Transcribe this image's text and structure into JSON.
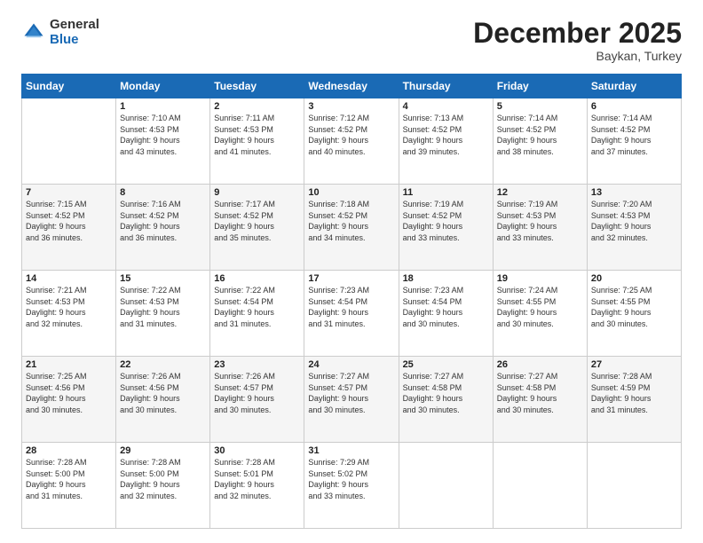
{
  "logo": {
    "general": "General",
    "blue": "Blue"
  },
  "header": {
    "month": "December 2025",
    "location": "Baykan, Turkey"
  },
  "weekdays": [
    "Sunday",
    "Monday",
    "Tuesday",
    "Wednesday",
    "Thursday",
    "Friday",
    "Saturday"
  ],
  "weeks": [
    [
      {
        "day": "",
        "info": ""
      },
      {
        "day": "1",
        "info": "Sunrise: 7:10 AM\nSunset: 4:53 PM\nDaylight: 9 hours\nand 43 minutes."
      },
      {
        "day": "2",
        "info": "Sunrise: 7:11 AM\nSunset: 4:53 PM\nDaylight: 9 hours\nand 41 minutes."
      },
      {
        "day": "3",
        "info": "Sunrise: 7:12 AM\nSunset: 4:52 PM\nDaylight: 9 hours\nand 40 minutes."
      },
      {
        "day": "4",
        "info": "Sunrise: 7:13 AM\nSunset: 4:52 PM\nDaylight: 9 hours\nand 39 minutes."
      },
      {
        "day": "5",
        "info": "Sunrise: 7:14 AM\nSunset: 4:52 PM\nDaylight: 9 hours\nand 38 minutes."
      },
      {
        "day": "6",
        "info": "Sunrise: 7:14 AM\nSunset: 4:52 PM\nDaylight: 9 hours\nand 37 minutes."
      }
    ],
    [
      {
        "day": "7",
        "info": "Sunrise: 7:15 AM\nSunset: 4:52 PM\nDaylight: 9 hours\nand 36 minutes."
      },
      {
        "day": "8",
        "info": "Sunrise: 7:16 AM\nSunset: 4:52 PM\nDaylight: 9 hours\nand 36 minutes."
      },
      {
        "day": "9",
        "info": "Sunrise: 7:17 AM\nSunset: 4:52 PM\nDaylight: 9 hours\nand 35 minutes."
      },
      {
        "day": "10",
        "info": "Sunrise: 7:18 AM\nSunset: 4:52 PM\nDaylight: 9 hours\nand 34 minutes."
      },
      {
        "day": "11",
        "info": "Sunrise: 7:19 AM\nSunset: 4:52 PM\nDaylight: 9 hours\nand 33 minutes."
      },
      {
        "day": "12",
        "info": "Sunrise: 7:19 AM\nSunset: 4:53 PM\nDaylight: 9 hours\nand 33 minutes."
      },
      {
        "day": "13",
        "info": "Sunrise: 7:20 AM\nSunset: 4:53 PM\nDaylight: 9 hours\nand 32 minutes."
      }
    ],
    [
      {
        "day": "14",
        "info": "Sunrise: 7:21 AM\nSunset: 4:53 PM\nDaylight: 9 hours\nand 32 minutes."
      },
      {
        "day": "15",
        "info": "Sunrise: 7:22 AM\nSunset: 4:53 PM\nDaylight: 9 hours\nand 31 minutes."
      },
      {
        "day": "16",
        "info": "Sunrise: 7:22 AM\nSunset: 4:54 PM\nDaylight: 9 hours\nand 31 minutes."
      },
      {
        "day": "17",
        "info": "Sunrise: 7:23 AM\nSunset: 4:54 PM\nDaylight: 9 hours\nand 31 minutes."
      },
      {
        "day": "18",
        "info": "Sunrise: 7:23 AM\nSunset: 4:54 PM\nDaylight: 9 hours\nand 30 minutes."
      },
      {
        "day": "19",
        "info": "Sunrise: 7:24 AM\nSunset: 4:55 PM\nDaylight: 9 hours\nand 30 minutes."
      },
      {
        "day": "20",
        "info": "Sunrise: 7:25 AM\nSunset: 4:55 PM\nDaylight: 9 hours\nand 30 minutes."
      }
    ],
    [
      {
        "day": "21",
        "info": "Sunrise: 7:25 AM\nSunset: 4:56 PM\nDaylight: 9 hours\nand 30 minutes."
      },
      {
        "day": "22",
        "info": "Sunrise: 7:26 AM\nSunset: 4:56 PM\nDaylight: 9 hours\nand 30 minutes."
      },
      {
        "day": "23",
        "info": "Sunrise: 7:26 AM\nSunset: 4:57 PM\nDaylight: 9 hours\nand 30 minutes."
      },
      {
        "day": "24",
        "info": "Sunrise: 7:27 AM\nSunset: 4:57 PM\nDaylight: 9 hours\nand 30 minutes."
      },
      {
        "day": "25",
        "info": "Sunrise: 7:27 AM\nSunset: 4:58 PM\nDaylight: 9 hours\nand 30 minutes."
      },
      {
        "day": "26",
        "info": "Sunrise: 7:27 AM\nSunset: 4:58 PM\nDaylight: 9 hours\nand 30 minutes."
      },
      {
        "day": "27",
        "info": "Sunrise: 7:28 AM\nSunset: 4:59 PM\nDaylight: 9 hours\nand 31 minutes."
      }
    ],
    [
      {
        "day": "28",
        "info": "Sunrise: 7:28 AM\nSunset: 5:00 PM\nDaylight: 9 hours\nand 31 minutes."
      },
      {
        "day": "29",
        "info": "Sunrise: 7:28 AM\nSunset: 5:00 PM\nDaylight: 9 hours\nand 32 minutes."
      },
      {
        "day": "30",
        "info": "Sunrise: 7:28 AM\nSunset: 5:01 PM\nDaylight: 9 hours\nand 32 minutes."
      },
      {
        "day": "31",
        "info": "Sunrise: 7:29 AM\nSunset: 5:02 PM\nDaylight: 9 hours\nand 33 minutes."
      },
      {
        "day": "",
        "info": ""
      },
      {
        "day": "",
        "info": ""
      },
      {
        "day": "",
        "info": ""
      }
    ]
  ]
}
